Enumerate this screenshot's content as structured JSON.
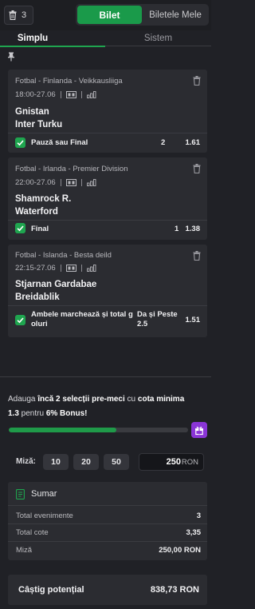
{
  "header": {
    "bet_count": "3",
    "tab_active": "Bilet",
    "tab_inactive": "Biletele Mele"
  },
  "subtabs": {
    "simple": "Simplu",
    "system": "Sistem"
  },
  "bets": [
    {
      "league": "Fotbal - Finlanda - Veikkausliiga",
      "time": "18:00-27.06",
      "home": "Gnistan",
      "away": "Inter Turku",
      "market": "Pauză sau Final",
      "selection": "2",
      "odd": "1.61"
    },
    {
      "league": "Fotbal - Irlanda - Premier Division",
      "time": "22:00-27.06",
      "home": "Shamrock R.",
      "away": "Waterford",
      "market": "Final",
      "selection": "1",
      "odd": "1.38"
    },
    {
      "league": "Fotbal - Islanda - Besta deild",
      "time": "22:15-27.06",
      "home": "Stjarnan Gardabae",
      "away": "Breidablik",
      "market_line1": "Ambele marchează și total g",
      "market_line2": "oluri",
      "selection_line1": "Da și Peste",
      "selection_line2": "2.5",
      "odd": "1.51"
    }
  ],
  "promo": {
    "p1": "Adauga ",
    "b1": "încă 2 selecții pre-meci",
    "p2": " cu ",
    "b2": "cota minima",
    "b3": "1.3",
    "p3": " pentru ",
    "b4": "6% Bonus",
    "p4": "!",
    "progress": 0.6
  },
  "stake": {
    "label": "Miză:",
    "chips": [
      "10",
      "20",
      "50"
    ],
    "value": "250",
    "currency": "RON"
  },
  "summary": {
    "title": "Sumar",
    "rows": [
      {
        "label": "Total evenimente",
        "value": "3"
      },
      {
        "label": "Total cote",
        "value": "3,35"
      },
      {
        "label": "Miză",
        "value": "250,00 RON"
      }
    ]
  },
  "payout": {
    "label": "Câștig potențial",
    "value": "838,73 RON"
  },
  "colors": {
    "accent": "#1fa54f",
    "gift": "#8a35d6",
    "background": "#202126",
    "card": "#2b2c31"
  }
}
